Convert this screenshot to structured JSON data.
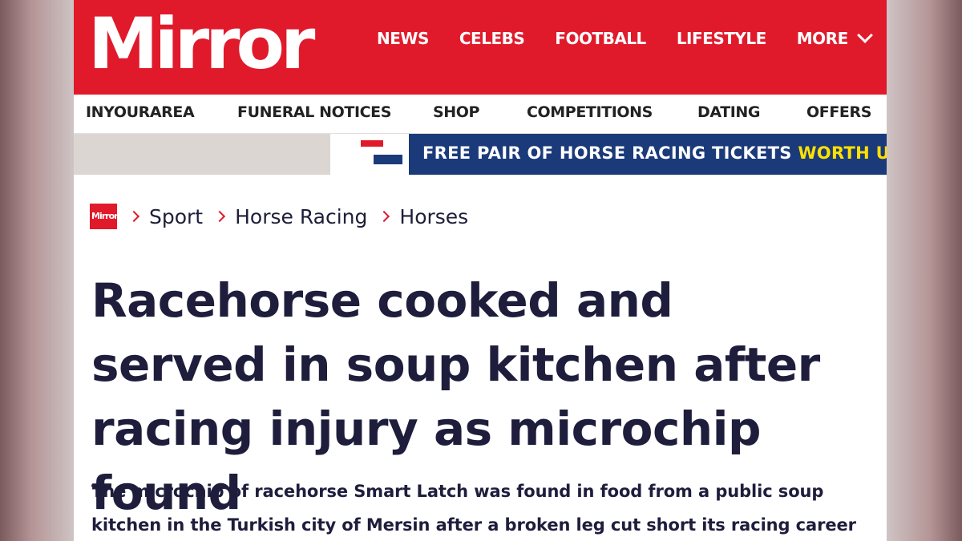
{
  "header": {
    "logo": "Mirror",
    "nav": [
      "NEWS",
      "CELEBS",
      "FOOTBALL",
      "LIFESTYLE"
    ],
    "more_label": "MORE",
    "brand_color": "#e01a2b"
  },
  "subnav": [
    "INYOURAREA",
    "FUNERAL NOTICES",
    "SHOP",
    "COMPETITIONS",
    "DATING",
    "OFFERS"
  ],
  "promo": {
    "banner_main": "FREE PAIR OF HORSE RACING TICKETS ",
    "banner_highlight": "WORTH UP TO",
    "banner_color": "#1b3a7a",
    "highlight_color": "#ffe100"
  },
  "breadcrumb": {
    "logo_text": "Mirror",
    "items": [
      "Sport",
      "Horse Racing",
      "Horses"
    ]
  },
  "article": {
    "headline": "Racehorse cooked and served in soup kitchen after racing injury as microchip found",
    "standfirst": "The microchip of racehorse Smart Latch was found in food from a public soup kitchen in the Turkish city of Mersin after a broken leg cut short its racing career"
  }
}
